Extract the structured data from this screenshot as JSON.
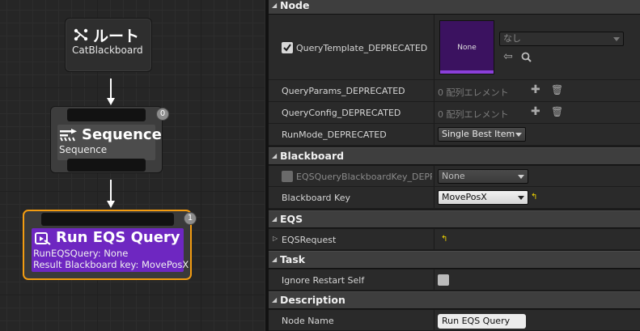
{
  "graph": {
    "root": {
      "title": "ルート",
      "subtitle": "CatBlackboard"
    },
    "sequence": {
      "title": "Sequence",
      "subtitle": "Sequence",
      "index": "0"
    },
    "eqs": {
      "title": "Run EQS Query",
      "line1": "RunEQSQuery: None",
      "line2": "Result Blackboard key: MovePosX",
      "index": "1"
    }
  },
  "details": {
    "node": {
      "header": "Node",
      "query_template": {
        "label": "QueryTemplate_DEPRECATED",
        "thumb_text": "None",
        "combo_value": "なし"
      },
      "query_params": {
        "label": "QueryParams_DEPRECATED",
        "value": "0 配列エレメント"
      },
      "query_config": {
        "label": "QueryConfig_DEPRECATED",
        "value": "0 配列エレメント"
      },
      "run_mode": {
        "label": "RunMode_DEPRECATED",
        "value": "Single Best Item"
      }
    },
    "blackboard": {
      "header": "Blackboard",
      "eqs_key": {
        "label": "EQSQueryBlackboardKey_DEPREC",
        "value": "None"
      },
      "bb_key": {
        "label": "Blackboard Key",
        "value": "MovePosX"
      }
    },
    "eqs": {
      "header": "EQS",
      "request": {
        "label": "EQSRequest"
      }
    },
    "task": {
      "header": "Task",
      "ignore_restart": {
        "label": "Ignore Restart Self",
        "checked": false
      }
    },
    "description": {
      "header": "Description",
      "node_name": {
        "label": "Node Name",
        "value": "Run EQS Query"
      }
    }
  },
  "colors": {
    "eqs_node": "#6e27c1",
    "selected_border": "#f39c11",
    "thumb": "#3b1260"
  }
}
